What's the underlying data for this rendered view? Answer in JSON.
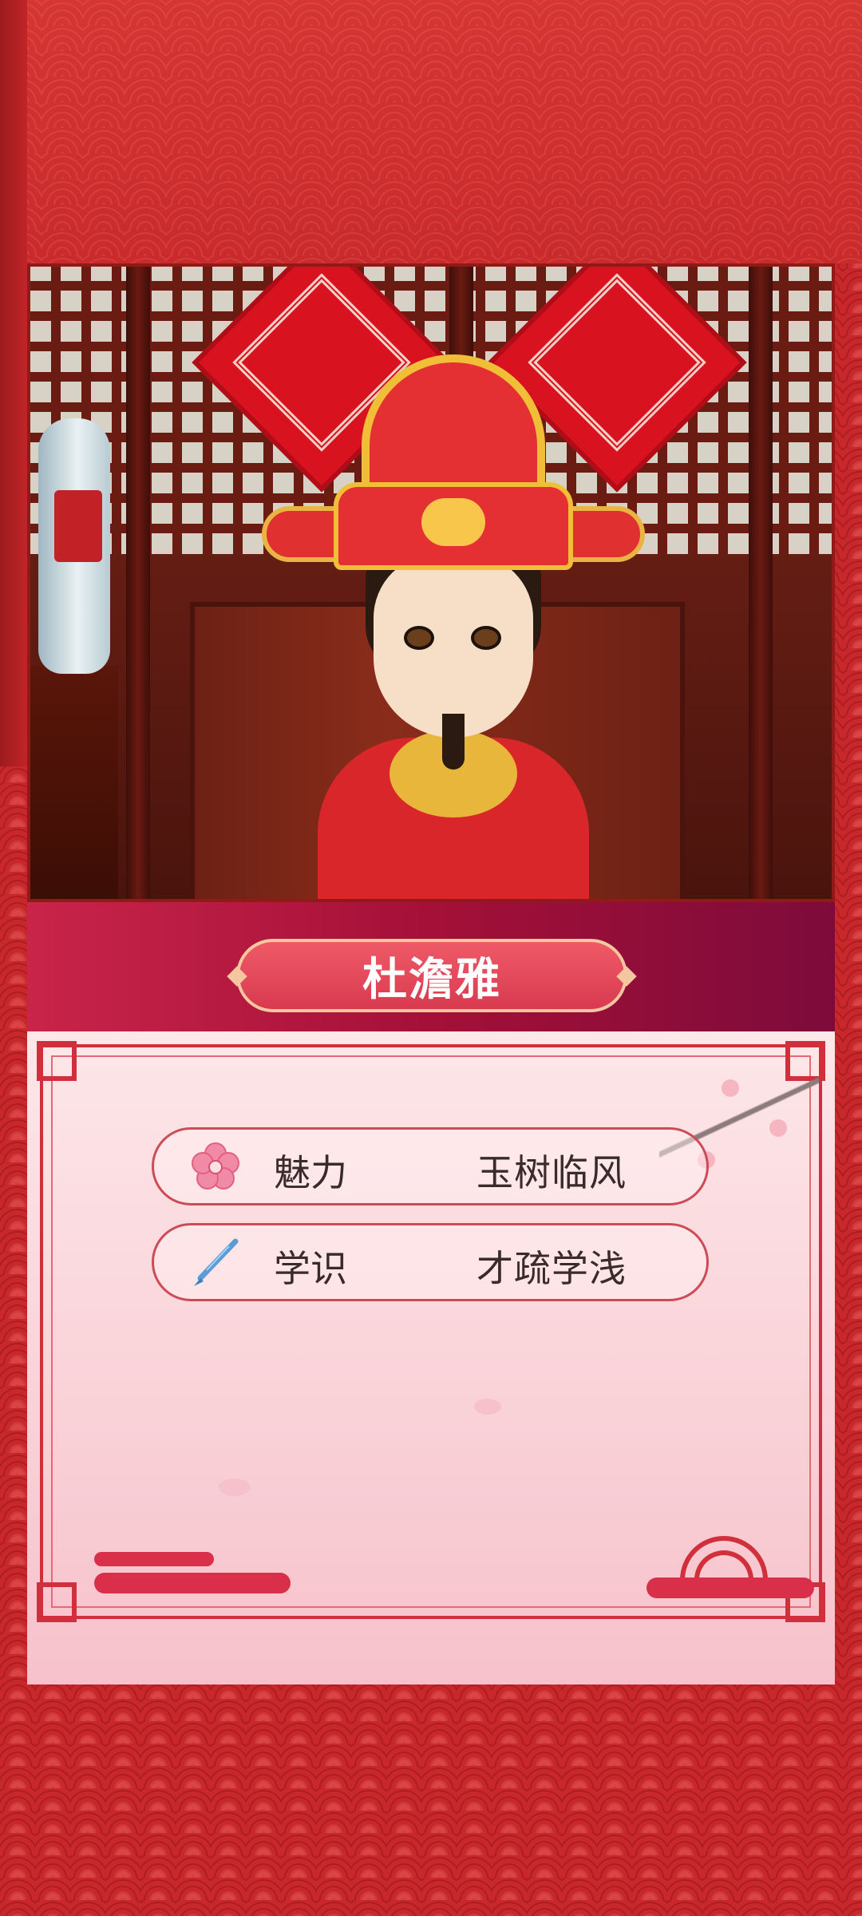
{
  "character": {
    "name": "杜澹雅",
    "portrait": "chinese-official-avatar"
  },
  "attributes": [
    {
      "icon": "plum-blossom-icon",
      "label": "魅力",
      "value": "玉树临风"
    },
    {
      "icon": "writing-brush-icon",
      "label": "学识",
      "value": "才疏学浅"
    }
  ],
  "theme": {
    "background": "#c8282b",
    "ribbon": "#a41038",
    "card": "#fde7e8",
    "accent": "#d22f3c"
  }
}
